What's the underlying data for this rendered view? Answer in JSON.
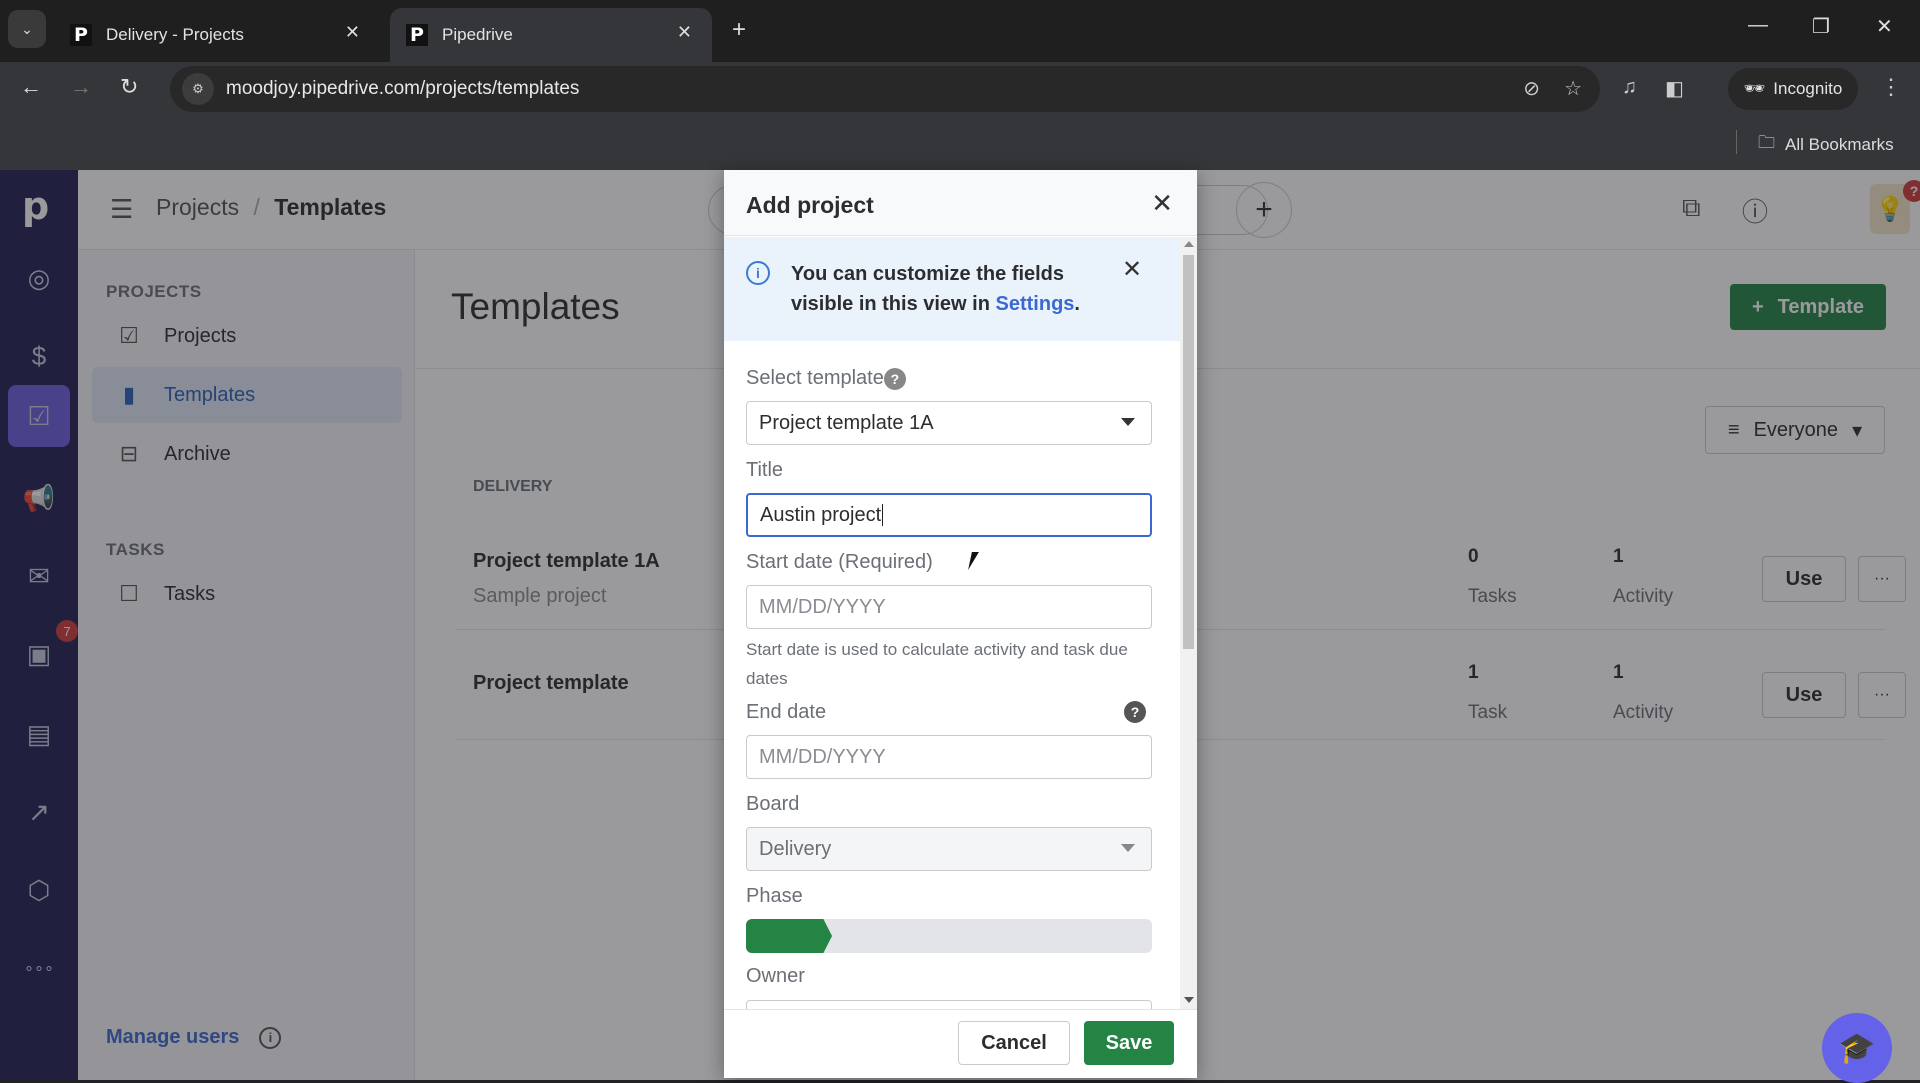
{
  "browser": {
    "tabs": [
      {
        "title": "Delivery - Projects",
        "favicon": "P",
        "active": false
      },
      {
        "title": "Pipedrive",
        "favicon": "P",
        "active": true
      }
    ],
    "url": "moodjoy.pipedrive.com/projects/templates",
    "incognito_label": "Incognito",
    "bookmarks_label": "All Bookmarks"
  },
  "rail": {
    "logo": "p",
    "items": [
      {
        "icon": "leads-target-icon",
        "glyph": "◎"
      },
      {
        "icon": "deals-dollar-icon",
        "glyph": "$"
      },
      {
        "icon": "projects-clipboard-icon",
        "glyph": "☑",
        "active": true
      },
      {
        "icon": "campaigns-megaphone-icon",
        "glyph": "📢"
      },
      {
        "icon": "mail-icon",
        "glyph": "✉"
      },
      {
        "icon": "activities-calendar-icon",
        "glyph": "▣",
        "badge": "7"
      },
      {
        "icon": "contacts-card-icon",
        "glyph": "▤"
      },
      {
        "icon": "insights-chart-icon",
        "glyph": "↗"
      },
      {
        "icon": "products-box-icon",
        "glyph": "⬡"
      },
      {
        "icon": "more-icon",
        "glyph": "∘∘∘"
      }
    ]
  },
  "topbar": {
    "breadcrumb_parent": "Projects",
    "breadcrumb_separator": "/",
    "breadcrumb_current": "Templates",
    "bulb_badge": "?"
  },
  "sidebar": {
    "section_projects": "PROJECTS",
    "items": [
      {
        "label": "Projects",
        "glyph": "☑"
      },
      {
        "label": "Templates",
        "glyph": "▮",
        "active": true
      },
      {
        "label": "Archive",
        "glyph": "⊟"
      }
    ],
    "section_tasks": "TASKS",
    "tasks_item": {
      "label": "Tasks",
      "glyph": "☐"
    },
    "manage_users": "Manage users"
  },
  "main": {
    "title": "Templates",
    "add_template_label": "Template",
    "filter_label": "Everyone",
    "group_label": "DELIVERY",
    "templates": [
      {
        "name": "Project template 1A",
        "description": "Sample project",
        "tasks_count": "0",
        "tasks_label": "Tasks",
        "activity_count": "1",
        "activity_label": "Activity",
        "use_label": "Use",
        "more_label": "···"
      },
      {
        "name": "Project template",
        "description": "",
        "tasks_count": "1",
        "tasks_label": "Task",
        "activity_count": "1",
        "activity_label": "Activity",
        "use_label": "Use",
        "more_label": "···"
      }
    ]
  },
  "modal": {
    "title": "Add project",
    "banner": {
      "text": "You can customize the fields visible in this view in ",
      "link": "Settings",
      "suffix": "."
    },
    "select_template_label": "Select template",
    "select_template_value": "Project template 1A",
    "title_label": "Title",
    "title_value": "Austin project",
    "start_date_label": "Start date (Required)",
    "start_date_placeholder": "MM/DD/YYYY",
    "start_date_hint": "Start date is used to calculate activity and task due dates",
    "end_date_label": "End date",
    "end_date_placeholder": "MM/DD/YYYY",
    "board_label": "Board",
    "board_value": "Delivery",
    "phase_label": "Phase",
    "phase": {
      "total": 5,
      "current": 1
    },
    "owner_label": "Owner",
    "cancel_label": "Cancel",
    "save_label": "Save"
  },
  "colors": {
    "accent_green": "#248444",
    "rail_bg": "#222253",
    "rail_active": "#6c5ddd",
    "link_blue": "#3a6ad1",
    "badge_red": "#d13b3b"
  }
}
